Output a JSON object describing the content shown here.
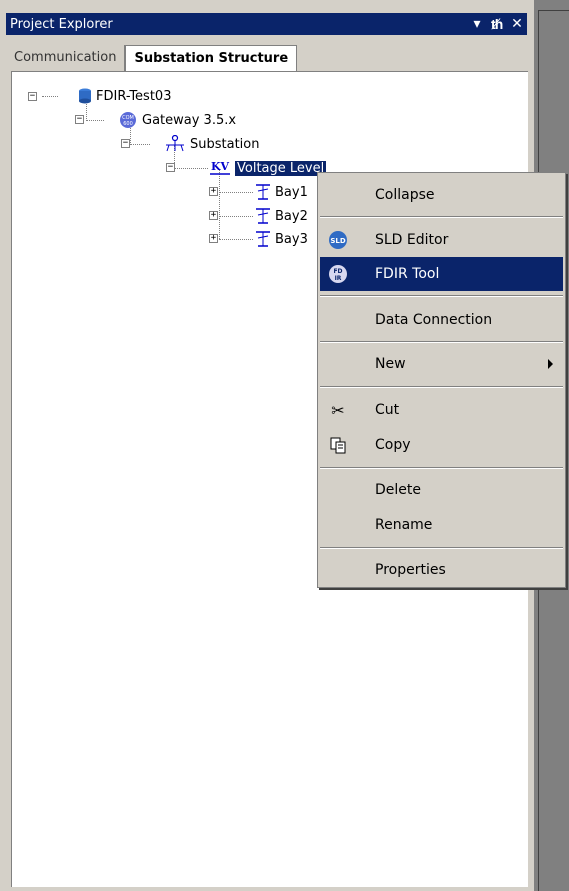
{
  "window": {
    "title": "Project Explorer",
    "buttons": {
      "pin": "↓ I",
      "dropdown": "▾",
      "autohide": "p",
      "close": "✕"
    }
  },
  "tabs": [
    {
      "label": "Communication",
      "active": false
    },
    {
      "label": "Substation Structure",
      "active": true
    }
  ],
  "tree": {
    "root": "FDIR-Test03",
    "gateway": "Gateway 3.5.x",
    "substation": "Substation",
    "voltage_level": "Voltage Level",
    "bays": [
      "Bay1",
      "Bay2",
      "Bay3"
    ]
  },
  "context_menu": {
    "items": [
      {
        "label": "Collapse"
      },
      {
        "label": "SLD Editor",
        "icon": "sld-icon"
      },
      {
        "label": "FDIR Tool",
        "icon": "fdir-icon",
        "selected": true
      },
      {
        "label": "Data Connection"
      },
      {
        "label": "New",
        "submenu": true
      },
      {
        "label": "Cut",
        "icon": "scissors-icon"
      },
      {
        "label": "Copy",
        "icon": "copy-icon"
      },
      {
        "label": "Delete"
      },
      {
        "label": "Rename"
      },
      {
        "label": "Properties"
      }
    ]
  },
  "colors": {
    "selection": "#0a246a",
    "panel": "#d4d0c8",
    "tree_icon": "#0000cc"
  }
}
